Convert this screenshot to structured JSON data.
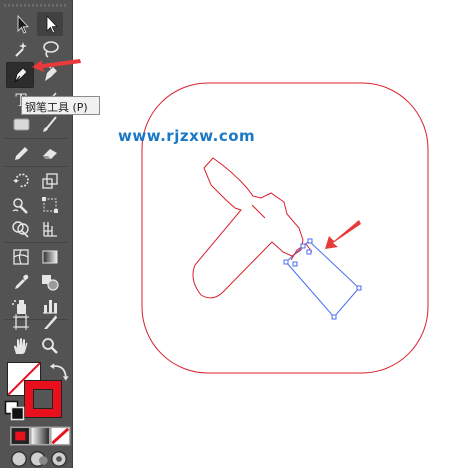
{
  "tooltip": {
    "text": "钢笔工具 (P)"
  },
  "watermark": {
    "text": "www.rjzxw.com"
  },
  "colors": {
    "toolbar_bg": "#535353",
    "canvas_bg": "#ffffff",
    "stroke_red": "#e8101c",
    "path_red": "#d9202a",
    "selection_blue": "#4a6cf0",
    "arrow_red": "#e83a3a",
    "watermark_blue": "#1b78c6"
  },
  "tools": [
    "selection-tool",
    "direct-selection-tool",
    "magic-wand-tool",
    "lasso-tool",
    "pen-tool",
    "curvature-tool",
    "type-tool",
    "line-segment-tool",
    "rectangle-tool",
    "paintbrush-tool",
    "pencil-tool",
    "eraser-tool",
    "rotate-tool",
    "scale-tool",
    "warp-tool",
    "free-transform-tool",
    "shape-builder-tool",
    "perspective-grid-tool",
    "mesh-tool",
    "gradient-tool",
    "eyedropper-tool",
    "blend-tool",
    "symbol-sprayer-tool",
    "column-graph-tool",
    "artboard-tool",
    "slice-tool",
    "hand-tool",
    "zoom-tool"
  ],
  "active_tool": "pen-tool",
  "color_controls": [
    "fill-swatch",
    "stroke-swatch",
    "swap-fill-stroke",
    "default-fill-stroke"
  ],
  "mode_buttons": [
    "color-mode",
    "gradient-mode",
    "none-mode"
  ],
  "screen_modes": [
    "draw-normal",
    "draw-behind",
    "draw-inside"
  ]
}
